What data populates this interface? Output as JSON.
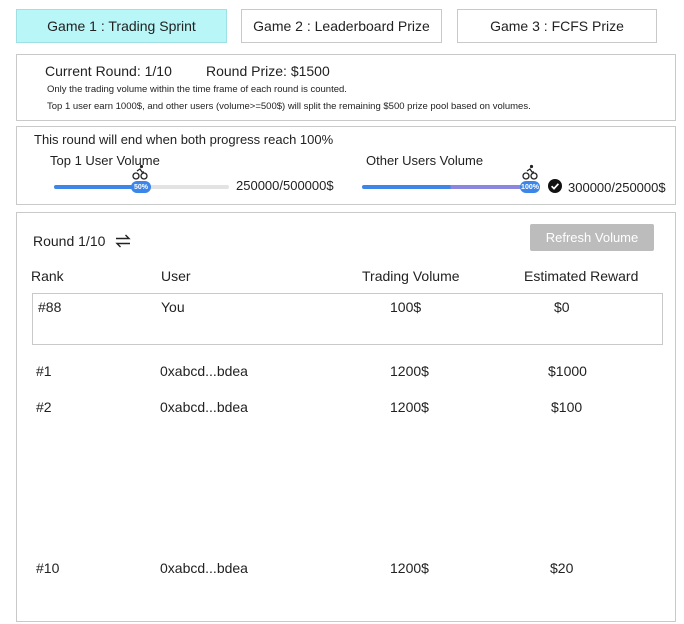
{
  "tabs": [
    {
      "label": "Game 1 : Trading Sprint"
    },
    {
      "label": "Game 2 : Leaderboard Prize"
    },
    {
      "label": "Game 3 : FCFS Prize"
    }
  ],
  "info": {
    "current_round": "Current Round: 1/10",
    "round_prize": "Round Prize: $1500",
    "note1": "Only the trading volume within the time frame of each round is counted.",
    "note2": "Top 1 user earn 1000$, and other users (volume>=500$) will split the remaining $500 prize pool based on volumes."
  },
  "progress": {
    "header": "This round will end when both progress reach 100%",
    "top1": {
      "label": "Top 1 User Volume",
      "badge": "50%",
      "value_text": "250000/500000$",
      "fraction": 0.5
    },
    "others": {
      "label": "Other Users Volume",
      "badge": "100%",
      "value_text": "300000/250000$",
      "fraction": 1.0
    }
  },
  "leaderboard": {
    "round_label": "Round 1/10",
    "refresh_label": "Refresh Volume",
    "columns": [
      "Rank",
      "User",
      "Trading Volume",
      "Estimated Reward"
    ],
    "you_row": {
      "rank": "#88",
      "user": "You",
      "volume": "100$",
      "reward": "$0"
    },
    "rows": [
      {
        "rank": "#1",
        "user": "0xabcd...bdea",
        "volume": "1200$",
        "reward": "$1000"
      },
      {
        "rank": "#2",
        "user": "0xabcd...bdea",
        "volume": "1200$",
        "reward": "$100"
      },
      {
        "rank": "#10",
        "user": "0xabcd...bdea",
        "volume": "1200$",
        "reward": "$20"
      }
    ]
  },
  "colors": {
    "active_tab": "#b8f6f7",
    "progress_blue": "#3b86e8",
    "progress_purple": "#8b86e0"
  }
}
